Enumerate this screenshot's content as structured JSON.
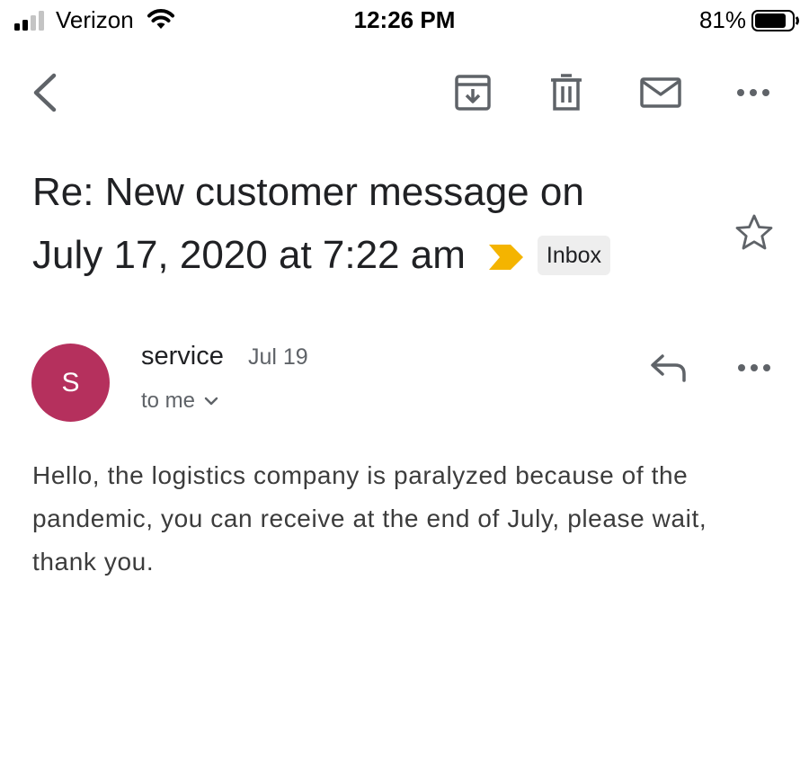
{
  "status_bar": {
    "carrier": "Verizon",
    "time": "12:26 PM",
    "battery_percent": "81%",
    "battery_level": 0.81,
    "signal_bars": 2,
    "icons": [
      "signal-icon",
      "wifi-icon",
      "battery-icon"
    ]
  },
  "toolbar": {
    "icons": [
      "back-icon",
      "archive-icon",
      "delete-icon",
      "mark-unread-icon",
      "more-icon"
    ]
  },
  "email": {
    "subject_line1": "Re: New customer message on",
    "subject_line2": "July 17, 2020 at 7:22 am",
    "label": "Inbox",
    "importance_color": "#f4b400",
    "sender": {
      "initial": "S",
      "name": "service",
      "avatar_color": "#b5305d"
    },
    "date": "Jul 19",
    "recipient": "to me",
    "body": "Hello, the logistics company is paralyzed because of the pandemic, you can receive at the end of July, please wait, thank you."
  }
}
